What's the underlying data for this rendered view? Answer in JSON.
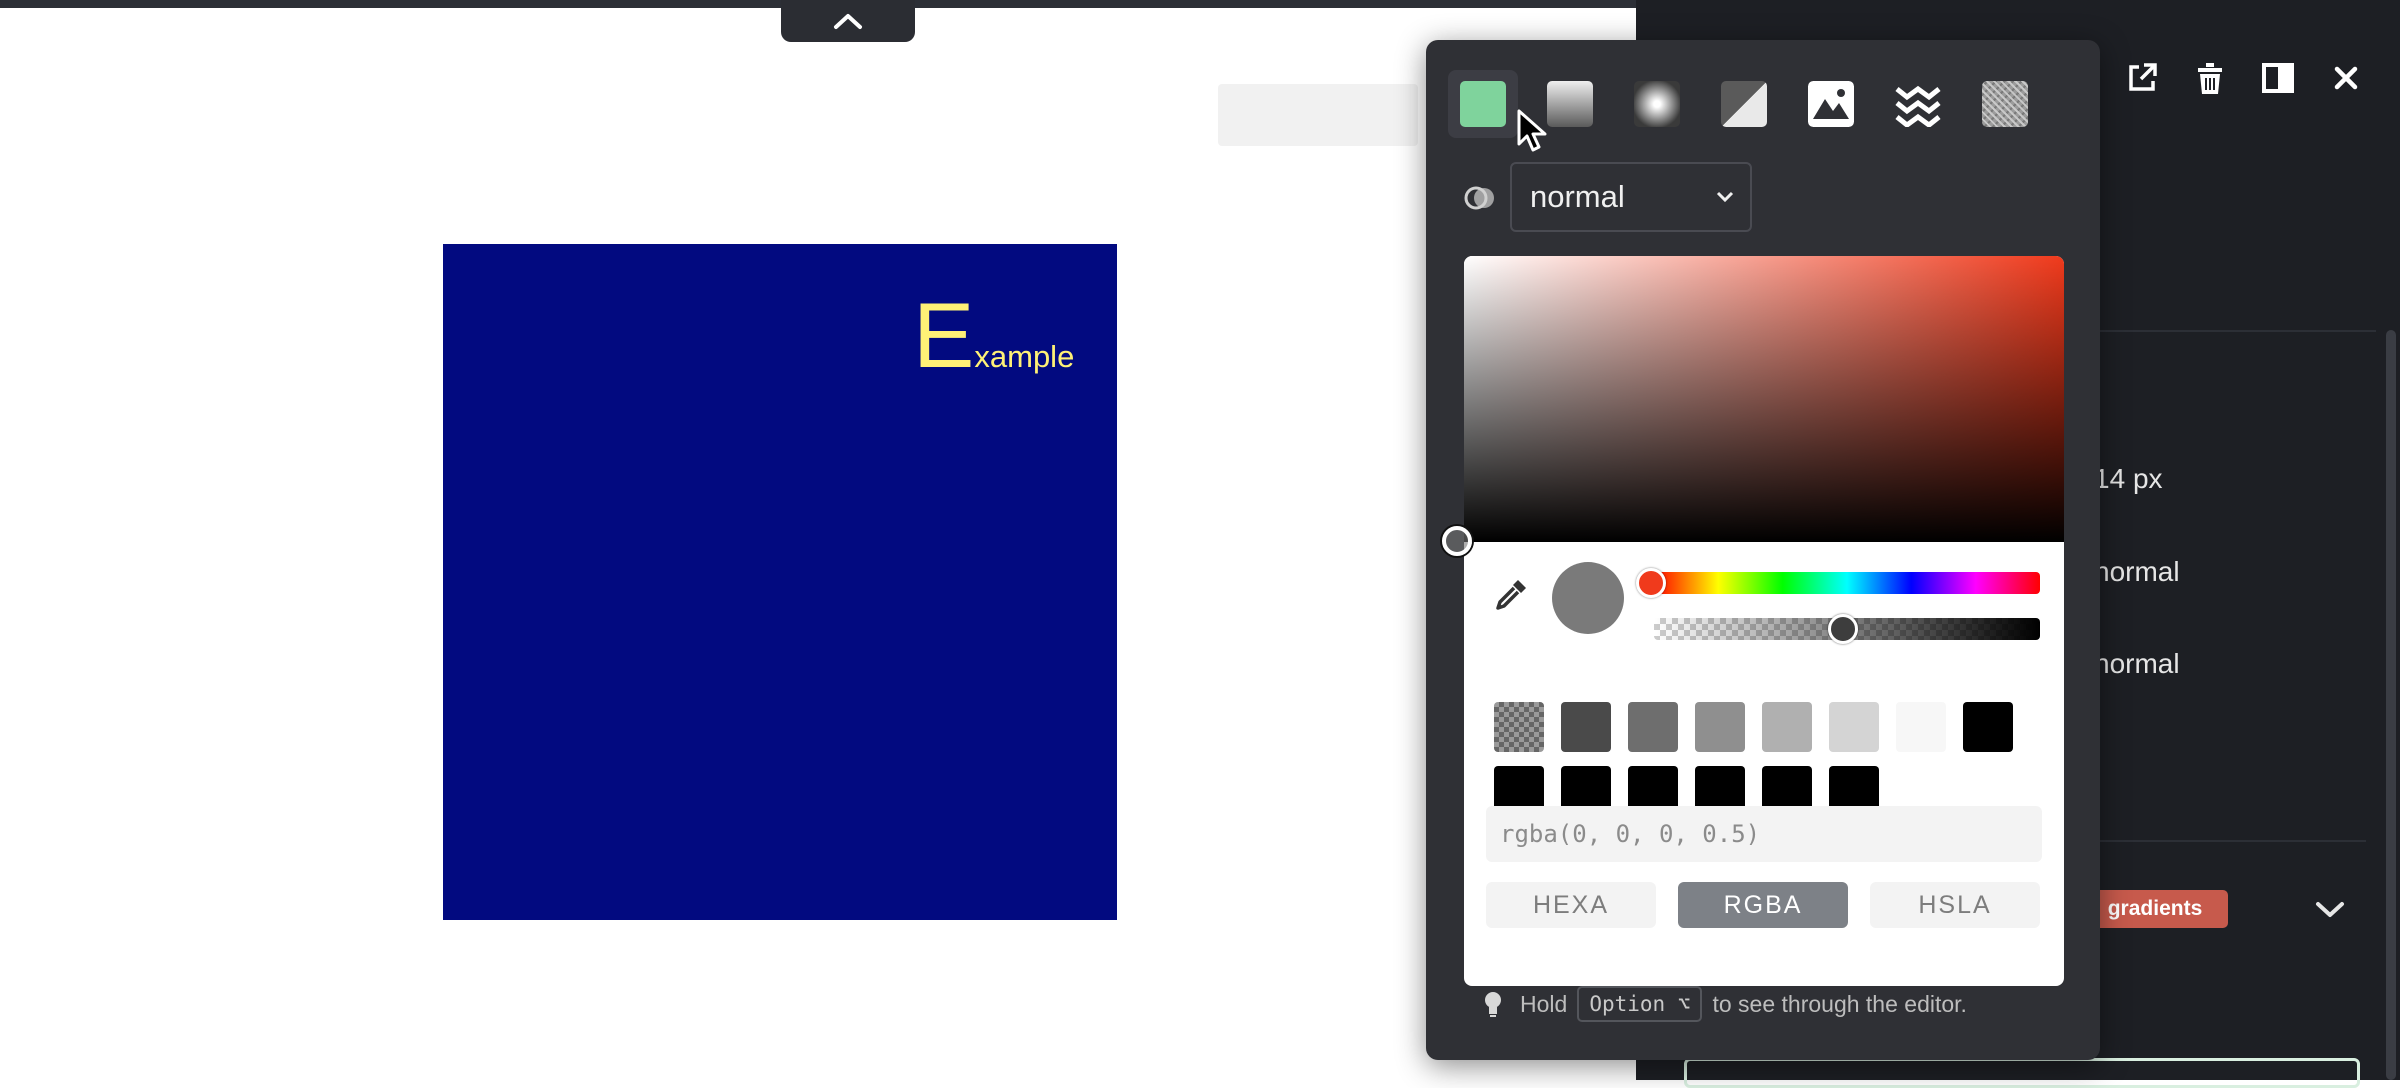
{
  "canvas": {
    "example_initial": "E",
    "example_rest": "xample",
    "box_color": "#020a80",
    "text_color": "#fff176"
  },
  "editor_toolbar": {
    "icons": [
      "external-link-icon",
      "trash-icon",
      "layout-toggle-icon",
      "close-icon"
    ]
  },
  "right_panel": {
    "size_value": "14",
    "size_unit": "px",
    "row_value_1": "normal",
    "row_value_2": "normal",
    "badge": "gradients"
  },
  "color_picker": {
    "mode_icons": [
      "solid-color-icon",
      "linear-gradient-icon",
      "radial-gradient-icon",
      "conic-gradient-icon",
      "image-icon",
      "pattern-icon",
      "noise-icon"
    ],
    "blend_mode": "normal",
    "hue_color": "#f03a1c",
    "preview_color": "#7a7a7a",
    "swatches_row1": [
      "checker",
      "#4a4a4a",
      "#6e6e6e",
      "#8f8f8f",
      "#b0b0b0",
      "#d4d4d4",
      "#f7f7f7",
      "#000000"
    ],
    "swatches_row2": [
      "#000000",
      "#000000",
      "#000000",
      "#000000",
      "#000000",
      "#000000"
    ],
    "value": "rgba(0, 0, 0, 0.5)",
    "formats": [
      "HEXA",
      "RGBA",
      "HSLA"
    ],
    "active_format": "RGBA",
    "hint_before": "Hold",
    "hint_key": "Option ⌥",
    "hint_after": "to see through the editor."
  }
}
